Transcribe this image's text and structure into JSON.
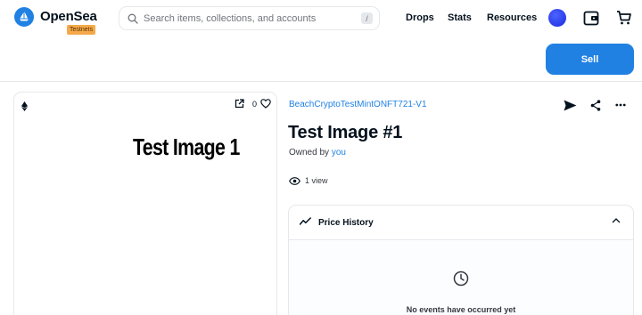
{
  "brand": {
    "name": "OpenSea",
    "badge": "Testnets",
    "logo_icon": "sailboat-icon"
  },
  "search": {
    "placeholder": "Search items, collections, and accounts",
    "shortcut": "/",
    "icon": "search-icon"
  },
  "nav": {
    "drops": "Drops",
    "stats": "Stats",
    "resources": "Resources"
  },
  "header_icons": [
    "avatar",
    "wallet-icon",
    "cart-icon"
  ],
  "actions": {
    "sell_label": "Sell"
  },
  "image_card": {
    "chain_icon": "ethereum-icon",
    "favorites_count": "0",
    "nft_text": "Test Image 1"
  },
  "item": {
    "collection": "BeachCryptoTestMintONFT721-V1",
    "title": "Test Image #1",
    "owned_by_prefix": "Owned by",
    "owner": "you",
    "views": "1 view"
  },
  "price_history": {
    "title": "Price History",
    "empty_text": "No events have occurred yet"
  },
  "colors": {
    "accent": "#2081e2",
    "avatar": "#2b3cf0",
    "badge": "#f5a94a",
    "text": "#04111d",
    "border": "#e5e8eb"
  }
}
